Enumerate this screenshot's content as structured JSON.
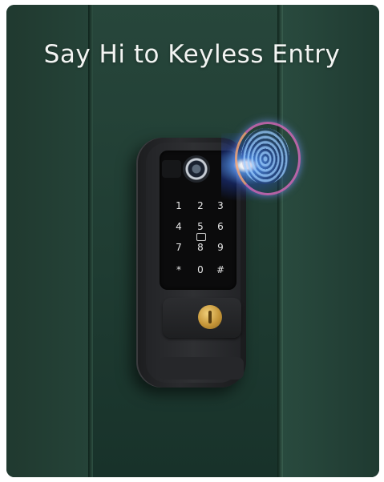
{
  "image": {
    "headline": "Say Hi to Keyless Entry",
    "keypad_keys": [
      "1",
      "2",
      "3",
      "4",
      "5",
      "6",
      "7",
      "8",
      "9",
      "*",
      "0",
      "#"
    ]
  }
}
